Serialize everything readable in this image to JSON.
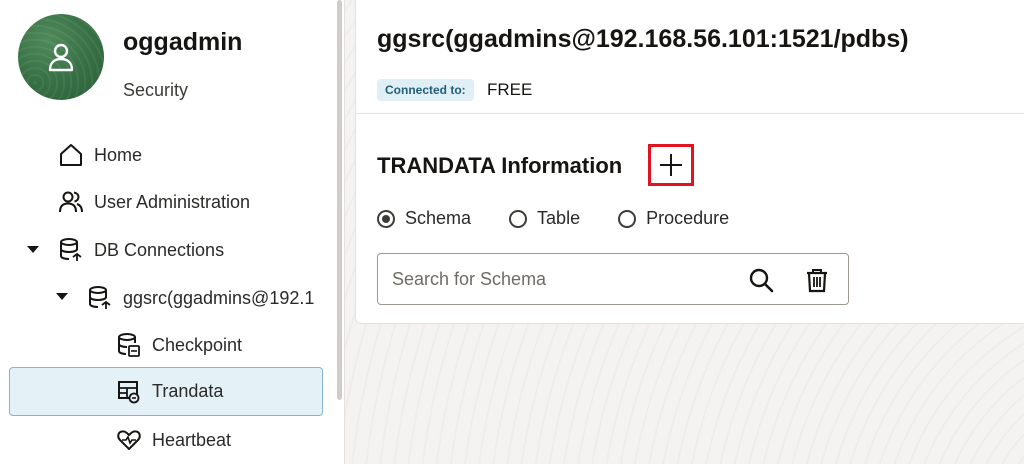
{
  "user": {
    "name": "oggadmin",
    "role": "Security"
  },
  "nav": {
    "home": "Home",
    "user_admin": "User Administration",
    "db_connections": "DB Connections",
    "connection": "ggsrc(ggadmins@192.1",
    "checkpoint": "Checkpoint",
    "trandata": "Trandata",
    "heartbeat": "Heartbeat"
  },
  "main": {
    "connection_title": "ggsrc(ggadmins@192.168.56.101:1521/pdbs)",
    "connected_label": "Connected to:",
    "connected_value": "FREE",
    "section_title": "TRANDATA Information",
    "radio": {
      "schema": "Schema",
      "table": "Table",
      "procedure": "Procedure",
      "selected": "Schema"
    },
    "search": {
      "placeholder": "Search for Schema",
      "value": ""
    }
  },
  "colors": {
    "accent_highlight": "#e0141e",
    "selected_bg": "#e4f1f7",
    "badge_bg": "#e0eef5",
    "avatar_green": "#3a7347"
  }
}
